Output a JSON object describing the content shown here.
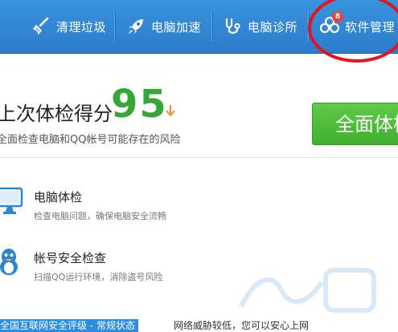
{
  "toolbar": {
    "tabs": [
      {
        "label": "清理垃圾",
        "icon": "broom-icon"
      },
      {
        "label": "电脑加速",
        "icon": "rocket-icon"
      },
      {
        "label": "电脑诊所",
        "icon": "stethoscope-icon"
      },
      {
        "label": "软件管理",
        "icon": "clover-icon",
        "badge": "8"
      }
    ],
    "highlight_color": "#e2141f"
  },
  "score": {
    "title": "上次体检得分",
    "value": "95",
    "trend_icon": "arrow-down-icon",
    "subtitle": "全面检查电脑和QQ帐号可能存在的风险",
    "button_label": "全面体检",
    "value_color": "#34a736"
  },
  "features": [
    {
      "title": "电脑体检",
      "desc": "检查电脑问题，确保电脑安全流畅",
      "icon": "monitor-icon"
    },
    {
      "title": "帐号安全检查",
      "desc": "扫描QQ运行环境，消除盗号风险",
      "icon": "qq-penguin-icon"
    }
  ],
  "bottom": {
    "highlight": "全国互联网安全评级 - 常规状态",
    "rest": "网络威胁较低，您可以安心上网"
  }
}
